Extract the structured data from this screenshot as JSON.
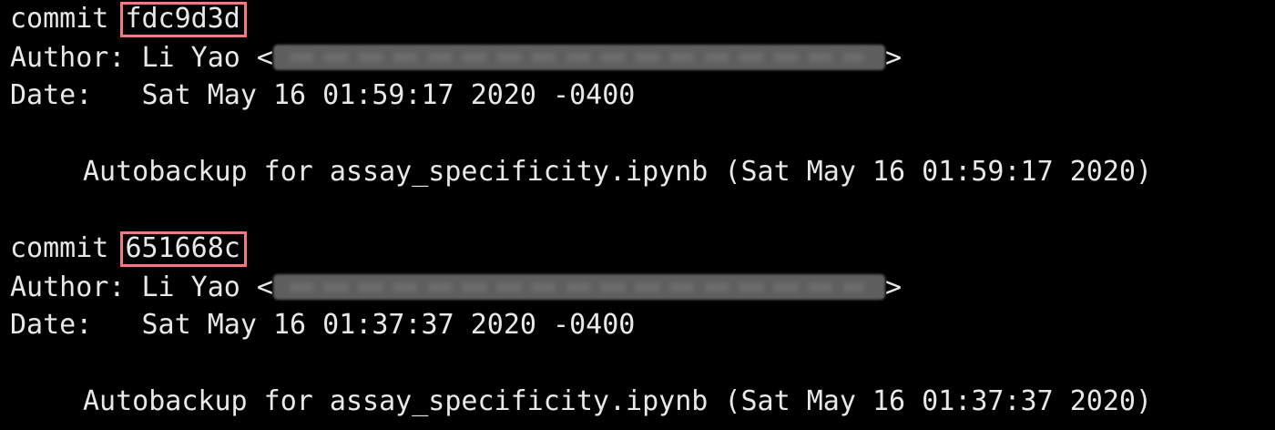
{
  "terminal": {
    "background_color": "#000000",
    "text_color": "#e8e8e8",
    "highlight_color": "#ee7a82",
    "commits": [
      {
        "commit_label": "commit ",
        "hash": "fdc9d3d",
        "author_label": "Author: ",
        "author_name": "Li Yao",
        "email_open": " <",
        "email_close": ">",
        "date_label": "Date:   ",
        "date": "Sat May 16 01:59:17 2020 -0400",
        "message": "Autobackup for assay_specificity.ipynb (Sat May 16 01:59:17 2020)"
      },
      {
        "commit_label": "commit ",
        "hash": "651668c",
        "author_label": "Author: ",
        "author_name": "Li Yao",
        "email_open": " <",
        "email_close": ">",
        "date_label": "Date:   ",
        "date": "Sat May 16 01:37:37 2020 -0400",
        "message": "Autobackup for assay_specificity.ipynb (Sat May 16 01:37:37 2020)"
      }
    ]
  }
}
